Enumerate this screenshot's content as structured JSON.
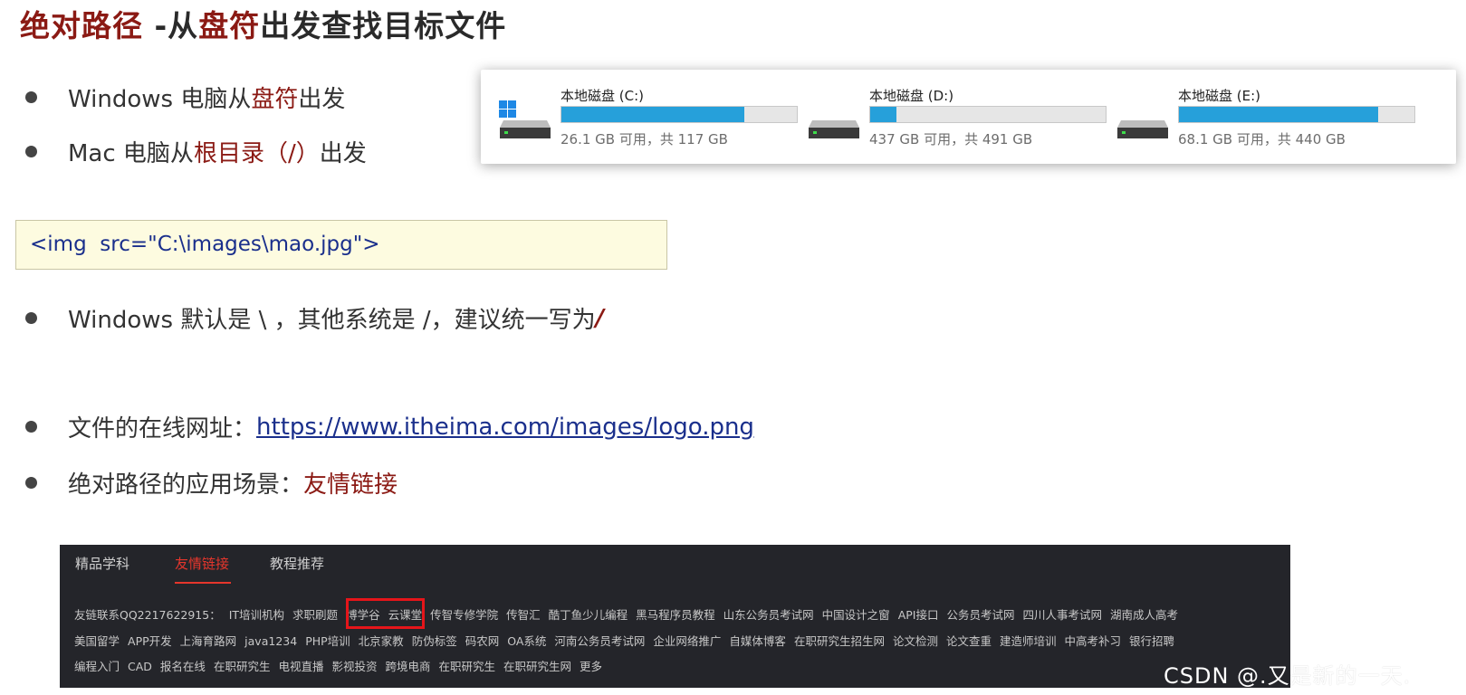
{
  "title": {
    "part1": "绝对路径",
    "part2": " -从",
    "part3": "盘符",
    "part4": "出发查找目标文件"
  },
  "bullets": {
    "b1": {
      "t1": "Windows 电脑从",
      "t2": "盘符",
      "t3": "出发"
    },
    "b2": {
      "t1": "Mac 电脑从",
      "t2": "根目录（/）",
      "t3": "出发"
    },
    "b3": {
      "t1": "Windows 默认是 \\ ，其他系统是 /，建议统一写为 ",
      "t2": "/"
    },
    "b4": {
      "t1": "文件的在线网址：",
      "t2": "https://www.itheima.com/images/logo.png"
    },
    "b5": {
      "t1": "绝对路径的应用场景：",
      "t2": "友情链接"
    }
  },
  "code": "<img  src=\"C:\\images\\mao.jpg\">",
  "disks": [
    {
      "name": "本地磁盘 (C:)",
      "info": "26.1 GB 可用，共 117 GB",
      "used_fraction": 0.777,
      "icon": "windows-logo-icon"
    },
    {
      "name": "本地磁盘 (D:)",
      "info": "437 GB 可用，共 491 GB",
      "used_fraction": 0.11,
      "icon": "hard-drive-icon"
    },
    {
      "name": "本地磁盘 (E:)",
      "info": "68.1 GB 可用，共 440 GB",
      "used_fraction": 0.845,
      "icon": "hard-drive-icon"
    }
  ],
  "footer": {
    "tabs": [
      "精品学科",
      "友情链接",
      "教程推荐"
    ],
    "active_tab": "友情链接",
    "rows": [
      [
        "友链联系QQ2217622915：",
        "IT培训机构",
        "求职刷题",
        "博学谷",
        "云课堂",
        "传智专修学院",
        "传智汇",
        "酷丁鱼少儿编程",
        "黑马程序员教程",
        "山东公务员考试网",
        "中国设计之窗",
        "API接口",
        "公务员考试网",
        "四川人事考试网",
        "湖南成人高考"
      ],
      [
        "美国留学",
        "APP开发",
        "上海育路网",
        "java1234",
        "PHP培训",
        "北京家教",
        "防伪标签",
        "码农网",
        "OA系统",
        "河南公务员考试网",
        "企业网络推广",
        "自媒体博客",
        "在职研究生招生网",
        "论文检测",
        "论文查重",
        "建造师培训",
        "中高考补习",
        "银行招聘"
      ],
      [
        "编程入门",
        "CAD",
        "报名在线",
        "在职研究生",
        "电视直播",
        "影视投资",
        "跨境电商",
        "在职研究生",
        "在职研究生网",
        "更多"
      ]
    ]
  },
  "watermark": "CSDN @.又是新的一天.",
  "colors": {
    "accent_red": "#8b1a14",
    "link_blue": "#1a2f8c",
    "disk_fill": "#26a0da",
    "footer_bg": "#24252a",
    "tab_active": "#e5362c"
  }
}
